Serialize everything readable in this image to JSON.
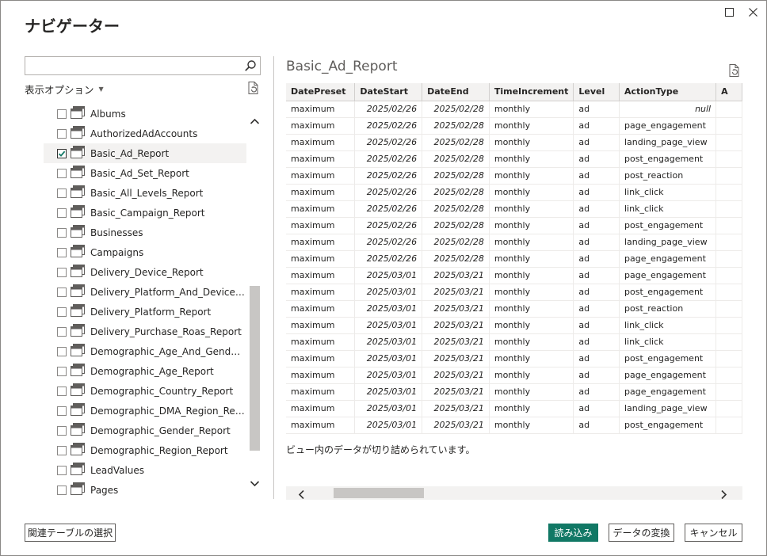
{
  "window": {
    "title": "ナビゲーター",
    "max_icon": "maximize-icon",
    "close_icon": "close-icon"
  },
  "left_panel": {
    "search": {
      "value": "",
      "placeholder": ""
    },
    "display_options_label": "表示オプション",
    "items": [
      {
        "label": "Albums",
        "checked": false
      },
      {
        "label": "AuthorizedAdAccounts",
        "checked": false
      },
      {
        "label": "Basic_Ad_Report",
        "checked": true
      },
      {
        "label": "Basic_Ad_Set_Report",
        "checked": false
      },
      {
        "label": "Basic_All_Levels_Report",
        "checked": false
      },
      {
        "label": "Basic_Campaign_Report",
        "checked": false
      },
      {
        "label": "Businesses",
        "checked": false
      },
      {
        "label": "Campaigns",
        "checked": false
      },
      {
        "label": "Delivery_Device_Report",
        "checked": false
      },
      {
        "label": "Delivery_Platform_And_Device_Rep...",
        "checked": false
      },
      {
        "label": "Delivery_Platform_Report",
        "checked": false
      },
      {
        "label": "Delivery_Purchase_Roas_Report",
        "checked": false
      },
      {
        "label": "Demographic_Age_And_Gender_Re...",
        "checked": false
      },
      {
        "label": "Demographic_Age_Report",
        "checked": false
      },
      {
        "label": "Demographic_Country_Report",
        "checked": false
      },
      {
        "label": "Demographic_DMA_Region_Report",
        "checked": false
      },
      {
        "label": "Demographic_Gender_Report",
        "checked": false
      },
      {
        "label": "Demographic_Region_Report",
        "checked": false
      },
      {
        "label": "LeadValues",
        "checked": false
      },
      {
        "label": "Pages",
        "checked": false
      }
    ]
  },
  "preview": {
    "title": "Basic_Ad_Report",
    "columns": [
      "DatePreset",
      "DateStart",
      "DateEnd",
      "TimeIncrement",
      "Level",
      "ActionType",
      "A"
    ],
    "rows": [
      [
        "maximum",
        "2025/02/26",
        "2025/02/28",
        "monthly",
        "ad",
        "null"
      ],
      [
        "maximum",
        "2025/02/26",
        "2025/02/28",
        "monthly",
        "ad",
        "page_engagement"
      ],
      [
        "maximum",
        "2025/02/26",
        "2025/02/28",
        "monthly",
        "ad",
        "landing_page_view"
      ],
      [
        "maximum",
        "2025/02/26",
        "2025/02/28",
        "monthly",
        "ad",
        "post_engagement"
      ],
      [
        "maximum",
        "2025/02/26",
        "2025/02/28",
        "monthly",
        "ad",
        "post_reaction"
      ],
      [
        "maximum",
        "2025/02/26",
        "2025/02/28",
        "monthly",
        "ad",
        "link_click"
      ],
      [
        "maximum",
        "2025/02/26",
        "2025/02/28",
        "monthly",
        "ad",
        "link_click"
      ],
      [
        "maximum",
        "2025/02/26",
        "2025/02/28",
        "monthly",
        "ad",
        "post_engagement"
      ],
      [
        "maximum",
        "2025/02/26",
        "2025/02/28",
        "monthly",
        "ad",
        "landing_page_view"
      ],
      [
        "maximum",
        "2025/02/26",
        "2025/02/28",
        "monthly",
        "ad",
        "page_engagement"
      ],
      [
        "maximum",
        "2025/03/01",
        "2025/03/21",
        "monthly",
        "ad",
        "page_engagement"
      ],
      [
        "maximum",
        "2025/03/01",
        "2025/03/21",
        "monthly",
        "ad",
        "post_engagement"
      ],
      [
        "maximum",
        "2025/03/01",
        "2025/03/21",
        "monthly",
        "ad",
        "post_reaction"
      ],
      [
        "maximum",
        "2025/03/01",
        "2025/03/21",
        "monthly",
        "ad",
        "link_click"
      ],
      [
        "maximum",
        "2025/03/01",
        "2025/03/21",
        "monthly",
        "ad",
        "link_click"
      ],
      [
        "maximum",
        "2025/03/01",
        "2025/03/21",
        "monthly",
        "ad",
        "post_engagement"
      ],
      [
        "maximum",
        "2025/03/01",
        "2025/03/21",
        "monthly",
        "ad",
        "page_engagement"
      ],
      [
        "maximum",
        "2025/03/01",
        "2025/03/21",
        "monthly",
        "ad",
        "page_engagement"
      ],
      [
        "maximum",
        "2025/03/01",
        "2025/03/21",
        "monthly",
        "ad",
        "landing_page_view"
      ],
      [
        "maximum",
        "2025/03/01",
        "2025/03/21",
        "monthly",
        "ad",
        "post_engagement"
      ]
    ],
    "truncated_message": "ビュー内のデータが切り詰められています。"
  },
  "buttons": {
    "related_tables": "関連テーブルの選択",
    "load": "読み込み",
    "transform": "データの変換",
    "cancel": "キャンセル"
  },
  "colors": {
    "primary": "#117865",
    "header_bg": "#f3f2f1",
    "scroll_thumb": "#c8c6c4"
  }
}
